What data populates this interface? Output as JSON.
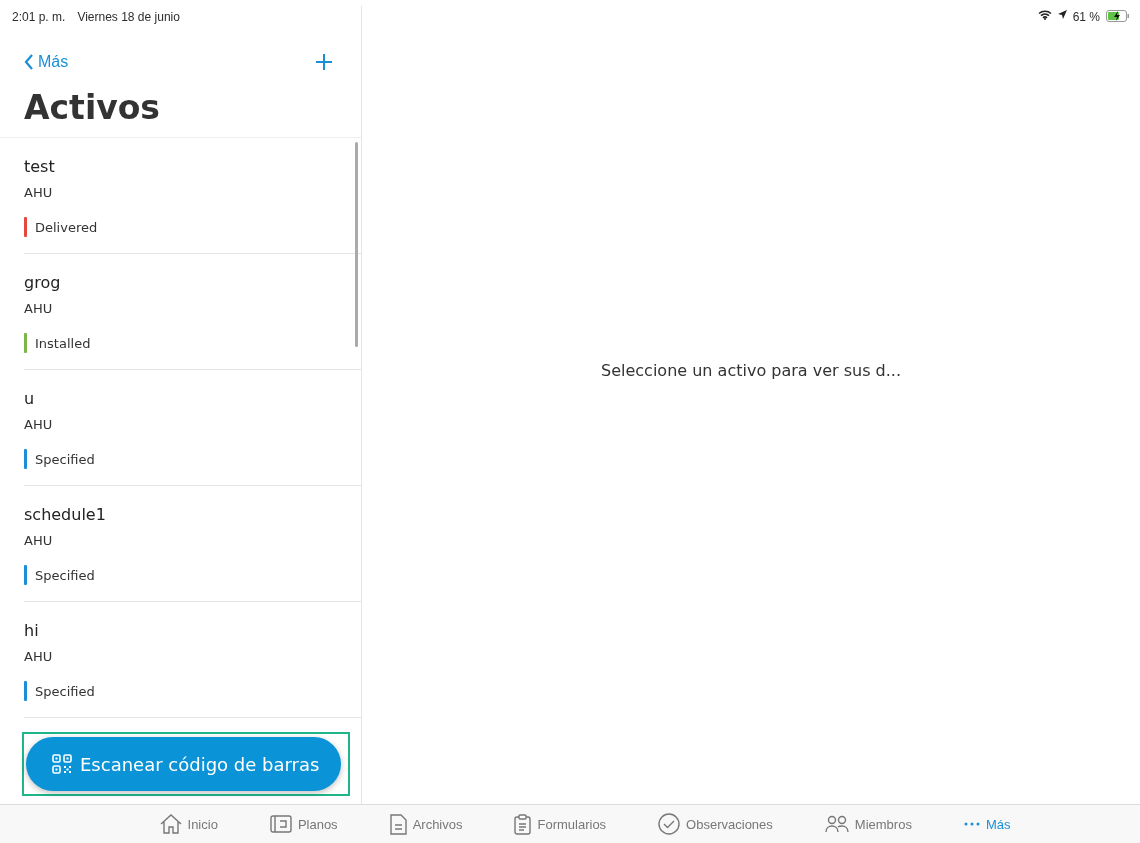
{
  "status_bar": {
    "time": "2:01 p. m.",
    "date": "Viernes 18 de junio",
    "battery": "61 %"
  },
  "nav": {
    "back": "Más"
  },
  "title": "Activos",
  "assets": [
    {
      "name": "test",
      "type": "AHU",
      "status": "Delivered",
      "color": "#e5483c"
    },
    {
      "name": "grog",
      "type": "AHU",
      "status": "Installed",
      "color": "#7ab648"
    },
    {
      "name": "u",
      "type": "AHU",
      "status": "Specified",
      "color": "#1a8fd8"
    },
    {
      "name": "schedule1",
      "type": "AHU",
      "status": "Specified",
      "color": "#1a8fd8"
    },
    {
      "name": "hi",
      "type": "AHU",
      "status": "Specified",
      "color": "#1a8fd8"
    }
  ],
  "scan_button": "Escanear código de barras",
  "detail_message": "Seleccione un activo para ver sus d...",
  "tabs": [
    {
      "label": "Inicio",
      "kind": "home",
      "selected": false
    },
    {
      "label": "Planos",
      "kind": "plans",
      "selected": false
    },
    {
      "label": "Archivos",
      "kind": "files",
      "selected": false
    },
    {
      "label": "Formularios",
      "kind": "forms",
      "selected": false
    },
    {
      "label": "Observaciones",
      "kind": "observations",
      "selected": false
    },
    {
      "label": "Miembros",
      "kind": "members",
      "selected": false
    },
    {
      "label": "Más",
      "kind": "more",
      "selected": true
    }
  ]
}
